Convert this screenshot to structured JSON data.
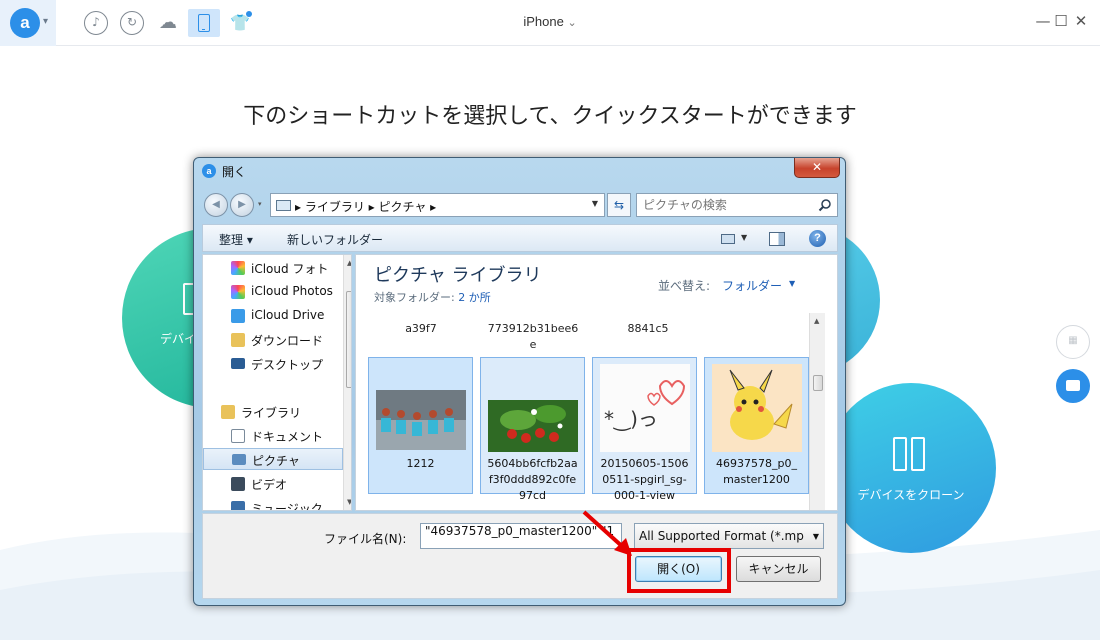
{
  "app": {
    "logo_letter": "a",
    "title": "iPhone",
    "title_chevron": "⌄",
    "toolbar_icons": [
      "music-icon",
      "restore-icon",
      "cloud-icon",
      "device-icon",
      "toolkit-shirt-icon"
    ],
    "window_controls": {
      "minimize": "—",
      "maximize": "☐",
      "close": "✕"
    }
  },
  "main": {
    "headline": "下のショートカットを選択して、クイックスタートができます",
    "shortcut_left_label": "デバイ",
    "shortcut_clone_label": "デバイスをクローン"
  },
  "dialog": {
    "title": "開く",
    "close_glyph": "✕",
    "address": "▸ ライブラリ ▸ ピクチャ ▸",
    "search_placeholder": "ピクチャの検索",
    "cmd_organize": "整理 ▾",
    "cmd_new_folder": "新しいフォルダー",
    "nav_items": [
      {
        "label": "iCloud フォト",
        "icon": "icloud-photos-icon"
      },
      {
        "label": "iCloud Photos",
        "icon": "icloud-photos-icon"
      },
      {
        "label": "iCloud Drive",
        "icon": "icloud-drive-icon"
      },
      {
        "label": "ダウンロード",
        "icon": "download-icon"
      },
      {
        "label": "デスクトップ",
        "icon": "desktop-icon"
      },
      {
        "label": "ライブラリ",
        "icon": "library-icon"
      },
      {
        "label": "ドキュメント",
        "icon": "document-icon"
      },
      {
        "label": "ピクチャ",
        "icon": "pictures-icon",
        "selected": true
      },
      {
        "label": "ビデオ",
        "icon": "video-icon"
      },
      {
        "label": "ミュージック",
        "icon": "music-icon"
      }
    ],
    "library_title": "ピクチャ ライブラリ",
    "library_sub_prefix": "対象フォルダー:",
    "library_sub_link": "2 か所",
    "sort_label": "並べ替え:",
    "sort_value": "フォルダー",
    "partial_items": [
      "a39f7",
      "773912b31bee6\ne",
      "8841c5"
    ],
    "tiles": [
      {
        "caption": "1212"
      },
      {
        "caption": "5604bb6fcfb2aa\nf3f0ddd892c0fe\n97cd"
      },
      {
        "caption": "20150605-1506\n0511-spgirl_sg-\n000-1-view"
      },
      {
        "caption": "46937578_p0_\nmaster1200"
      }
    ],
    "filename_label": "ファイル名(N):",
    "filename_value": "\"46937578_p0_master1200\" \"1",
    "filetype_value": "All Supported Format (*.mp",
    "open_button": "開く(O)",
    "cancel_button": "キャンセル"
  },
  "colors": {
    "accent": "#2c8fe8",
    "highlight": "#e60000"
  }
}
